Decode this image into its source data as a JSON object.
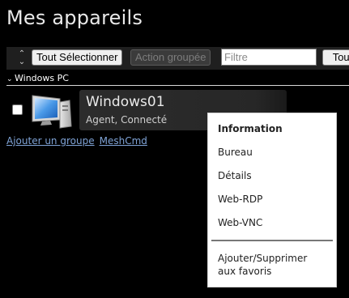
{
  "page": {
    "title": "Mes appareils"
  },
  "toolbar": {
    "collapse_icon": "collapse-icon",
    "select_all_label": "Tout Sélectionner",
    "group_action_label": "Action groupée",
    "filter_placeholder": "Filtre",
    "filter_value": "",
    "extra_label": "Tout"
  },
  "group": {
    "name": "Windows PC",
    "chevron_icon": "chevron-down-icon"
  },
  "device": {
    "name": "Windows01",
    "status": "Agent, Connecté",
    "icon": "windows-computer-icon",
    "checked": false
  },
  "links": [
    {
      "label": "Ajouter un groupe"
    },
    {
      "label": "MeshCmd"
    }
  ],
  "context_menu": {
    "items": [
      {
        "label": "Information",
        "bold": true
      },
      {
        "label": "Bureau"
      },
      {
        "label": "Détails"
      },
      {
        "label": "Web-RDP"
      },
      {
        "label": "Web-VNC"
      }
    ],
    "favorites_line1": "Ajouter/Supprimer",
    "favorites_line2": "aux favoris"
  }
}
